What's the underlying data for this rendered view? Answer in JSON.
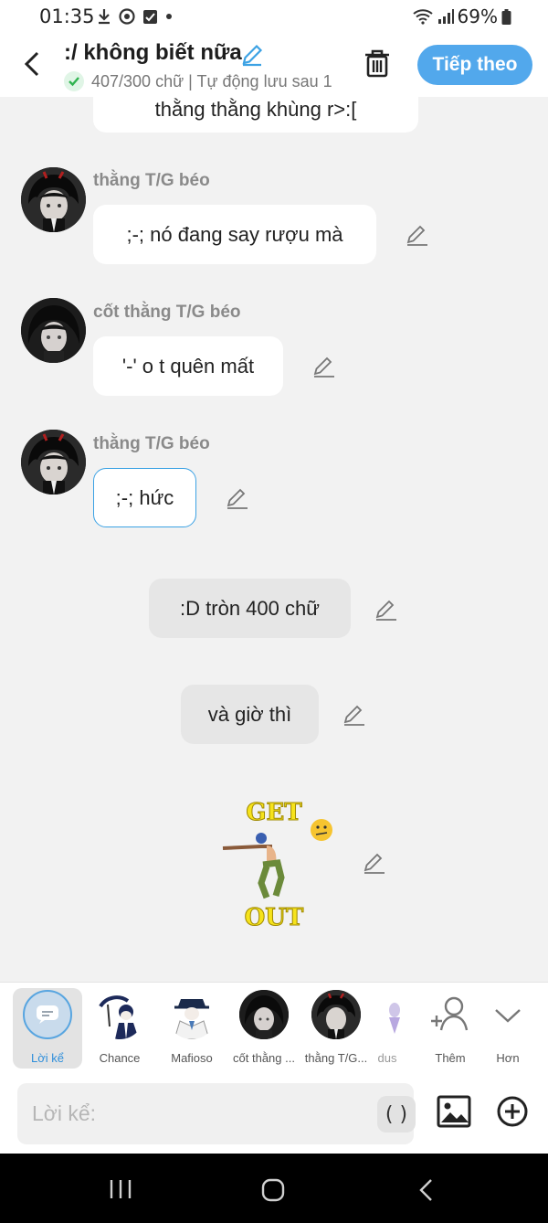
{
  "status": {
    "time": "01:35",
    "battery": "69%"
  },
  "header": {
    "title": ":/ không biết nữa",
    "subtitle": "407/300 chữ | Tự động lưu sau 1",
    "next_label": "Tiếp theo"
  },
  "messages": [
    {
      "speaker": "",
      "text": "thằng thằng khùng r>:["
    },
    {
      "speaker": "thằng T/G béo",
      "text": ";-; nó đang say rượu mà"
    },
    {
      "speaker": "cốt thằng T/G béo",
      "text": "'-' o t quên mất"
    },
    {
      "speaker": "thằng T/G béo",
      "text": ";-; hức"
    },
    {
      "speaker": "",
      "text": ":D tròn 400 chữ"
    },
    {
      "speaker": "",
      "text": "và giờ thì"
    }
  ],
  "sticker": {
    "top_text": "GET",
    "bottom_text": "OUT"
  },
  "characters": [
    {
      "label": "Lời kể"
    },
    {
      "label": "Chance"
    },
    {
      "label": "Mafioso"
    },
    {
      "label": "cốt thằng ..."
    },
    {
      "label": "thằng T/G..."
    },
    {
      "label": "dus"
    },
    {
      "label": "Thêm"
    },
    {
      "label": "Hơn"
    }
  ],
  "input": {
    "placeholder": "Lời kể:",
    "paren_label": "( )"
  },
  "colors": {
    "accent": "#52a8ec",
    "selected_border": "#3ca2e4"
  }
}
